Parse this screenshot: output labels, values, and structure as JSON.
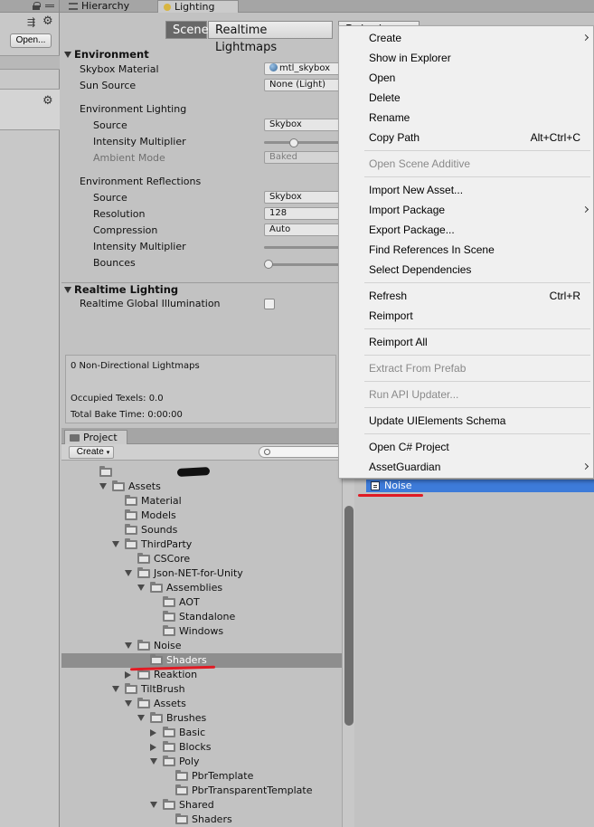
{
  "tabs": {
    "hierarchy": "Hierarchy",
    "lighting": "Lighting",
    "project": "Project"
  },
  "left_panel": {
    "open_button": "Open..."
  },
  "lighting": {
    "toolbar": {
      "scene": "Scene",
      "realtime_lightmaps": "Realtime Lightmaps",
      "baked_lightmaps": "Baked Lightmaps"
    },
    "environment": {
      "header": "Environment",
      "skybox_material_label": "Skybox Material",
      "skybox_material_value": "mtl_skybox",
      "sun_source_label": "Sun Source",
      "sun_source_value": "None (Light)",
      "env_lighting_header": "Environment Lighting",
      "source_label": "Source",
      "source_value": "Skybox",
      "intensity_label": "Intensity Multiplier",
      "intensity_level": 0.38,
      "ambient_mode_label": "Ambient Mode",
      "ambient_mode_value": "Baked",
      "env_reflections_header": "Environment Reflections",
      "refl_source_label": "Source",
      "refl_source_value": "Skybox",
      "resolution_label": "Resolution",
      "resolution_value": "128",
      "compression_label": "Compression",
      "compression_value": "Auto",
      "refl_intensity_label": "Intensity Multiplier",
      "bounces_label": "Bounces",
      "bounces_level": 0.0
    },
    "realtime": {
      "header": "Realtime Lighting",
      "rgi_label": "Realtime Global Illumination",
      "rgi_checked": false
    },
    "stats": {
      "lightmaps": "0 Non-Directional Lightmaps",
      "occupied_texels": "Occupied Texels: 0.0",
      "total_bake_time": "Total Bake Time: 0:00:00"
    }
  },
  "project": {
    "create_label": "Create",
    "tree": [
      {
        "label": "",
        "depth": 0,
        "arrow": "none",
        "redacted": true
      },
      {
        "label": "Assets",
        "depth": 1,
        "arrow": "open"
      },
      {
        "label": "Material",
        "depth": 2,
        "arrow": "none"
      },
      {
        "label": "Models",
        "depth": 2,
        "arrow": "none"
      },
      {
        "label": "Sounds",
        "depth": 2,
        "arrow": "none"
      },
      {
        "label": "ThirdParty",
        "depth": 2,
        "arrow": "open"
      },
      {
        "label": "CSCore",
        "depth": 3,
        "arrow": "none"
      },
      {
        "label": "Json-NET-for-Unity",
        "depth": 3,
        "arrow": "open"
      },
      {
        "label": "Assemblies",
        "depth": 4,
        "arrow": "open"
      },
      {
        "label": "AOT",
        "depth": 5,
        "arrow": "none"
      },
      {
        "label": "Standalone",
        "depth": 5,
        "arrow": "none"
      },
      {
        "label": "Windows",
        "depth": 5,
        "arrow": "none"
      },
      {
        "label": "Noise",
        "depth": 3,
        "arrow": "open"
      },
      {
        "label": "Shaders",
        "depth": 4,
        "arrow": "none",
        "selected": true
      },
      {
        "label": "Reaktion",
        "depth": 3,
        "arrow": "closed"
      },
      {
        "label": "TiltBrush",
        "depth": 2,
        "arrow": "open"
      },
      {
        "label": "Assets",
        "depth": 3,
        "arrow": "open"
      },
      {
        "label": "Brushes",
        "depth": 4,
        "arrow": "open"
      },
      {
        "label": "Basic",
        "depth": 5,
        "arrow": "closed"
      },
      {
        "label": "Blocks",
        "depth": 5,
        "arrow": "closed"
      },
      {
        "label": "Poly",
        "depth": 5,
        "arrow": "open"
      },
      {
        "label": "PbrTemplate",
        "depth": 6,
        "arrow": "none"
      },
      {
        "label": "PbrTransparentTemplate",
        "depth": 6,
        "arrow": "none"
      },
      {
        "label": "Shared",
        "depth": 5,
        "arrow": "open"
      },
      {
        "label": "Shaders",
        "depth": 6,
        "arrow": "none"
      }
    ],
    "selected_asset": "Noise"
  },
  "context_menu": {
    "items": [
      {
        "label": "Create",
        "submenu": true
      },
      {
        "label": "Show in Explorer"
      },
      {
        "label": "Open"
      },
      {
        "label": "Delete"
      },
      {
        "label": "Rename"
      },
      {
        "label": "Copy Path",
        "shortcut": "Alt+Ctrl+C"
      },
      {
        "separator": true
      },
      {
        "label": "Open Scene Additive",
        "disabled": true
      },
      {
        "separator": true
      },
      {
        "label": "Import New Asset..."
      },
      {
        "label": "Import Package",
        "submenu": true
      },
      {
        "label": "Export Package..."
      },
      {
        "label": "Find References In Scene"
      },
      {
        "label": "Select Dependencies"
      },
      {
        "separator": true
      },
      {
        "label": "Refresh",
        "shortcut": "Ctrl+R"
      },
      {
        "label": "Reimport"
      },
      {
        "separator": true
      },
      {
        "label": "Reimport All"
      },
      {
        "separator": true
      },
      {
        "label": "Extract From Prefab",
        "disabled": true
      },
      {
        "separator": true
      },
      {
        "label": "Run API Updater...",
        "disabled": true
      },
      {
        "separator": true
      },
      {
        "label": "Update UIElements Schema"
      },
      {
        "separator": true
      },
      {
        "label": "Open C# Project"
      },
      {
        "label": "AssetGuardian",
        "submenu": true
      }
    ]
  },
  "colors": {
    "selection_blue": "#3d7bd9",
    "annotation_red": "#e01b24",
    "active_toolbar": "#686868"
  }
}
